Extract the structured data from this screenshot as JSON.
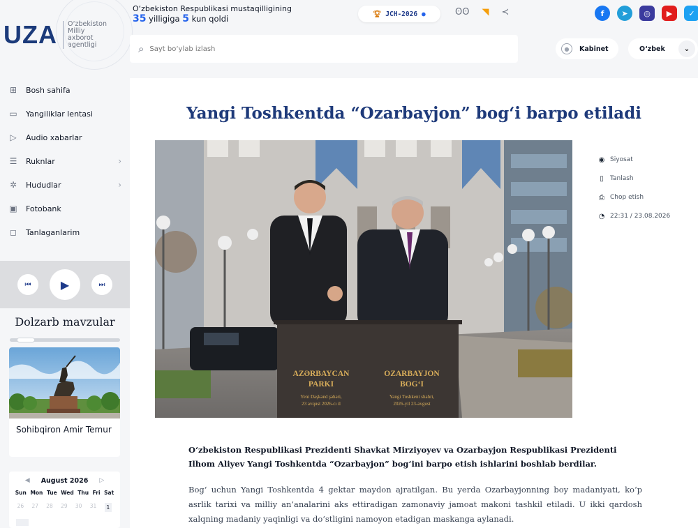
{
  "header": {
    "logo_text": "UZA",
    "logo_sub": "O‘zbekiston Milliy axborot agentligi",
    "independence_line1": "O‘zbekiston Respublikasi mustaqilligining",
    "independence_years": "35",
    "independence_mid": "yilligiga",
    "independence_days": "5",
    "independence_end": "kun qoldi",
    "jch_label": "JCH-2026",
    "search_placeholder": "Sayt bo‘ylab izlash",
    "kabinet_label": "Kabinet",
    "language": "O‘zbek",
    "header_icons": [
      "glasses-icon",
      "rss-icon",
      "share-icon"
    ],
    "socials": [
      "facebook",
      "telegram",
      "instagram",
      "youtube",
      "twitter"
    ]
  },
  "sidebar": {
    "items": [
      {
        "label": "Bosh sahifa",
        "icon": "grid-icon",
        "has_arrow": false
      },
      {
        "label": "Yangiliklar lentasi",
        "icon": "feed-icon",
        "has_arrow": false
      },
      {
        "label": "Audio xabarlar",
        "icon": "play-square-icon",
        "has_arrow": false
      },
      {
        "label": "Ruknlar",
        "icon": "list-icon",
        "has_arrow": true
      },
      {
        "label": "Hududlar",
        "icon": "map-icon",
        "has_arrow": true
      },
      {
        "label": "Fotobank",
        "icon": "image-icon",
        "has_arrow": false
      },
      {
        "label": "Tanlaganlarim",
        "icon": "bookmark-icon",
        "has_arrow": false
      }
    ],
    "topics_title": "Dolzarb mavzular",
    "topic_caption": "Sohibqiron Amir Temur",
    "calendar": {
      "month": "August 2026",
      "weekdays": [
        "Sun",
        "Mon",
        "Tue",
        "Wed",
        "Thu",
        "Fri",
        "Sat"
      ],
      "first_row": [
        "26",
        "27",
        "28",
        "29",
        "30",
        "31",
        "1"
      ]
    }
  },
  "article": {
    "title": "Yangi Toshkentda “Ozarbayjon” bog‘i barpo etiladi",
    "category": "Siyosat",
    "bookmark_label": "Tanlash",
    "print_label": "Chop etish",
    "datetime": "22:31 / 23.08.2026",
    "plaque_left_title1": "AZƏRBAYCAN",
    "plaque_left_title2": "PARKI",
    "plaque_left_sub1": "Yeni Daşkənd şəhəri,",
    "plaque_left_sub2": "23 avqust 2026-cı il",
    "plaque_right_title1": "OZARBAYJON",
    "plaque_right_title2": "BOG‘I",
    "plaque_right_sub1": "Yangi Toshkent shahri,",
    "plaque_right_sub2": "2026-yil 23-avgust",
    "lead": "O‘zbekiston Respublikasi Prezidenti Shavkat Mirziyoyev va Ozarbayjon Respublikasi Prezidenti Ilhom Aliyev Yangi Toshkentda “Ozarbayjon” bog‘ini barpo etish ishlarini boshlab berdilar.",
    "body": "Bog‘ uchun Yangi Toshkentda 4 gektar maydon ajratilgan. Bu yerda Ozarbayjonning boy madaniyati, ko‘p asrlik tarixi va milliy an’analarini aks ettiradigan zamonaviy jamoat makoni tashkil etiladi. U ikki qardosh xalqning madaniy yaqinligi va do‘stligini namoyon etadigan maskanga aylanadi."
  }
}
